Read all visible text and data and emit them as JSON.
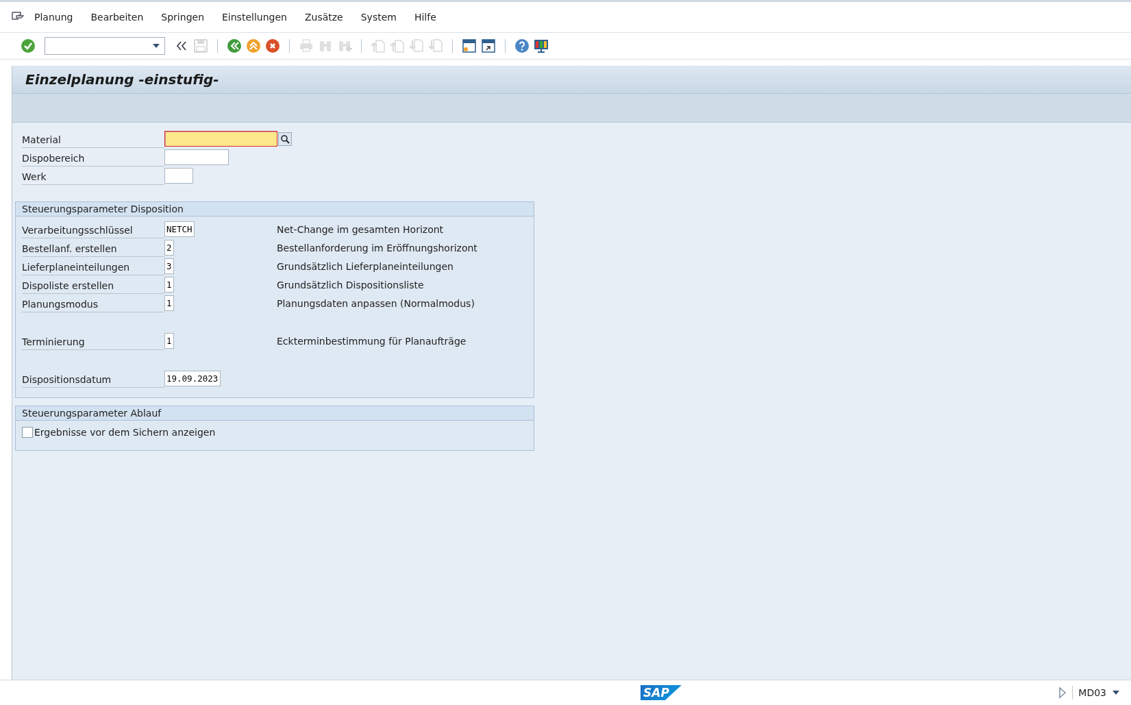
{
  "menu": [
    {
      "label": "Planung"
    },
    {
      "label": "Bearbeiten"
    },
    {
      "label": "Springen"
    },
    {
      "label": "Einstellungen"
    },
    {
      "label": "Zusätze"
    },
    {
      "label": "System"
    },
    {
      "label": "Hilfe"
    }
  ],
  "toolbar": [
    {
      "kind": "enter",
      "disabled": false
    },
    {
      "kind": "command-field"
    },
    {
      "kind": "collapse",
      "disabled": false
    },
    {
      "kind": "save",
      "disabled": true
    },
    {
      "kind": "separator"
    },
    {
      "kind": "back",
      "disabled": false
    },
    {
      "kind": "exit",
      "disabled": false
    },
    {
      "kind": "cancel",
      "disabled": false
    },
    {
      "kind": "separator"
    },
    {
      "kind": "print",
      "disabled": true
    },
    {
      "kind": "find",
      "disabled": true
    },
    {
      "kind": "find-next",
      "disabled": true
    },
    {
      "kind": "separator"
    },
    {
      "kind": "first-page",
      "disabled": true
    },
    {
      "kind": "prev-page",
      "disabled": true
    },
    {
      "kind": "next-page",
      "disabled": true
    },
    {
      "kind": "last-page",
      "disabled": true
    },
    {
      "kind": "separator"
    },
    {
      "kind": "new-session",
      "disabled": false
    },
    {
      "kind": "shortcut",
      "disabled": false
    },
    {
      "kind": "separator"
    },
    {
      "kind": "help",
      "disabled": false
    },
    {
      "kind": "layout",
      "disabled": false
    }
  ],
  "title": "Einzelplanung -einstufig-",
  "fields": [
    {
      "label": "Material",
      "focused": true
    },
    {
      "label": "Dispobereich",
      "focused": false
    },
    {
      "label": "Werk",
      "focused": false
    }
  ],
  "groups": [
    {
      "title": "Steuerungsparameter Disposition",
      "blocks": [
        {
          "rows": [
            {
              "label": "Verarbeitungsschlüssel",
              "value": "NETCH",
              "description": "Net-Change im gesamten Horizont"
            },
            {
              "label": "Bestellanf. erstellen",
              "value": "2",
              "description": "Bestellanforderung im Eröffnungshorizont"
            },
            {
              "label": "Lieferplaneinteilungen",
              "value": "3",
              "description": "Grundsätzlich Lieferplaneinteilungen"
            },
            {
              "label": "Dispoliste erstellen",
              "value": "1",
              "description": "Grundsätzlich Dispositionsliste"
            },
            {
              "label": "Planungsmodus",
              "value": "1",
              "description": "Planungsdaten anpassen (Normalmodus)"
            }
          ]
        },
        {
          "rows": [
            {
              "label": "Terminierung",
              "value": "1",
              "description": "Eckterminbestimmung für Planaufträge"
            }
          ]
        },
        {
          "rows": [
            {
              "label": "Dispositionsdatum",
              "value": "19.09.2023"
            }
          ]
        }
      ]
    },
    {
      "title": "Steuerungsparameter Ablauf",
      "checkboxes": [
        {
          "label": "Ergebnisse vor dem Sichern anzeigen",
          "checked": false
        }
      ]
    }
  ],
  "status_bar": {
    "logo": "SAP",
    "transaction": "MD03"
  }
}
